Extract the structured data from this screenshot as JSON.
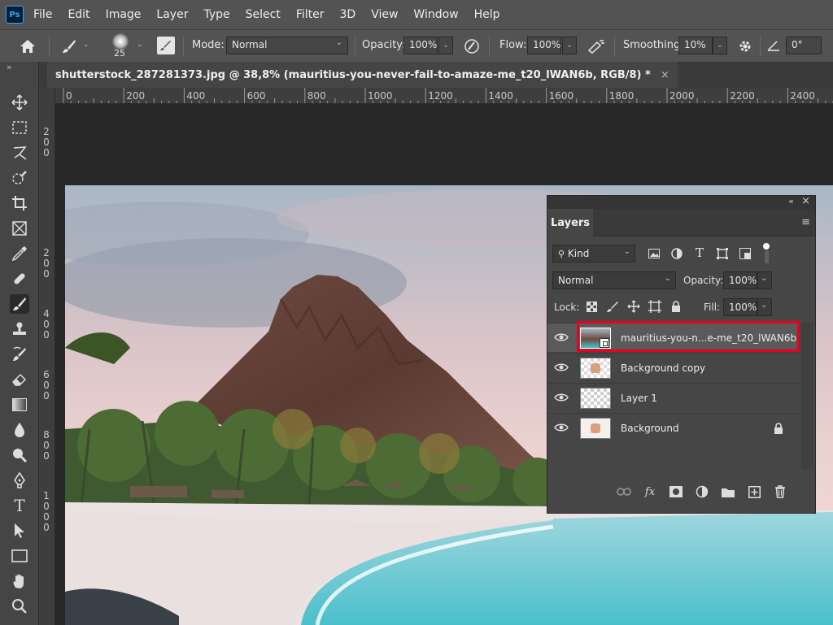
{
  "app": {
    "logo": "Ps",
    "accent": "#31a8ff"
  },
  "menu": [
    "File",
    "Edit",
    "Image",
    "Layer",
    "Type",
    "Select",
    "Filter",
    "3D",
    "View",
    "Window",
    "Help"
  ],
  "options": {
    "brush_size": "25",
    "mode_label": "Mode:",
    "mode_value": "Normal",
    "opacity_label": "Opacity:",
    "opacity_value": "100%",
    "flow_label": "Flow:",
    "flow_value": "100%",
    "smoothing_label": "Smoothing:",
    "smoothing_value": "10%",
    "angle_value": "0°"
  },
  "document": {
    "tab_title": "shutterstock_287281373.jpg @ 38,8% (mauritius-you-never-fail-to-amaze-me_t20_lWAN6b, RGB/8) *",
    "close_glyph": "×"
  },
  "ruler": {
    "horizontal": [
      "0",
      "200",
      "400",
      "600",
      "800",
      "1000",
      "1200",
      "1400",
      "1600",
      "1800",
      "2000",
      "2200",
      "2400"
    ],
    "vertical": [
      "2\n0\n0",
      "2\n0\n0",
      "4\n0\n0",
      "6\n0\n0",
      "8\n0\n0",
      "1\n0\n0\n0"
    ]
  },
  "layers_panel": {
    "tab": "Layers",
    "filter_kind": "Kind",
    "blend_mode": "Normal",
    "opacity_label": "Opacity:",
    "opacity_value": "100%",
    "lock_label": "Lock:",
    "fill_label": "Fill:",
    "fill_value": "100%",
    "highlight_color": "#e8001c",
    "layers": [
      {
        "name": "mauritius-you-n...e-me_t20_lWAN6b",
        "visible": true,
        "selected": true,
        "locked": false
      },
      {
        "name": "Background copy",
        "visible": true,
        "selected": false,
        "locked": false
      },
      {
        "name": "Layer 1",
        "visible": true,
        "selected": false,
        "locked": false
      },
      {
        "name": "Background",
        "visible": true,
        "selected": false,
        "locked": true
      }
    ]
  }
}
